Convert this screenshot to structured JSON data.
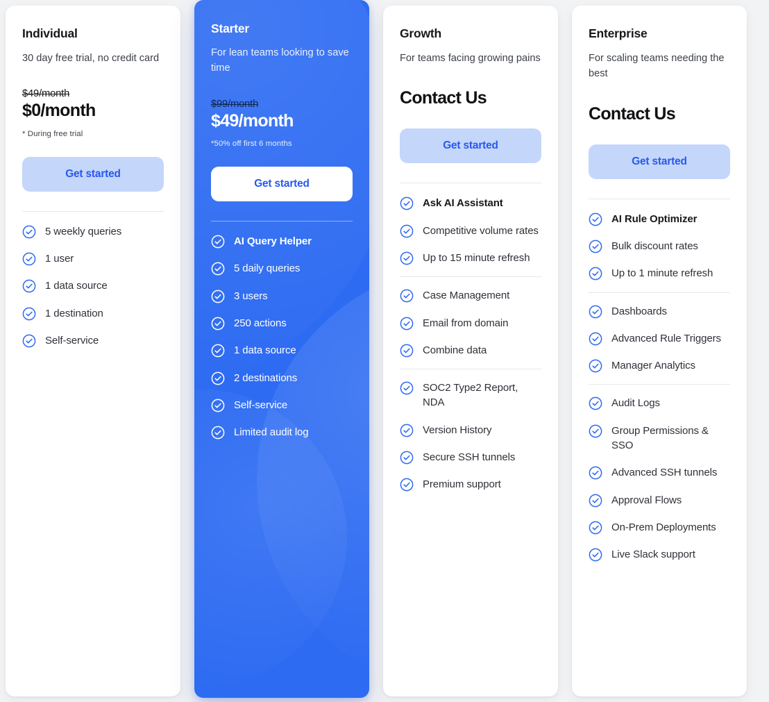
{
  "theme": {
    "page_background": "#f2f3f5",
    "featured_card_background": "#2d6bf2",
    "accent_blue": "#2558ee",
    "cta_light_background": "#c5d6fb",
    "check_icon_color": "#2f6bf0"
  },
  "icons": {
    "check": "check-circle-icon"
  },
  "plans": [
    {
      "id": "individual",
      "name": "Individual",
      "tagline": "30 day free trial, no credit card",
      "price_old": "$49/month",
      "price_new": "$0/month",
      "price_note": "* During free trial",
      "cta_label": "Get started",
      "feature_groups": [
        {
          "items": [
            {
              "label": "5 weekly queries",
              "bold": false
            },
            {
              "label": "1 user",
              "bold": false
            },
            {
              "label": "1 data source",
              "bold": false
            },
            {
              "label": "1 destination",
              "bold": false
            },
            {
              "label": "Self-service",
              "bold": false
            }
          ]
        }
      ]
    },
    {
      "id": "starter",
      "name": "Starter",
      "tagline": "For lean teams looking to save time",
      "price_old": "$99/month",
      "price_new": "$49/month",
      "price_note": "*50% off first 6 months",
      "cta_label": "Get started",
      "feature_groups": [
        {
          "items": [
            {
              "label": "AI Query Helper",
              "bold": true
            },
            {
              "label": "5 daily queries",
              "bold": false
            },
            {
              "label": "3 users",
              "bold": false
            },
            {
              "label": "250 actions",
              "bold": false
            },
            {
              "label": "1 data source",
              "bold": false
            },
            {
              "label": "2 destinations",
              "bold": false
            },
            {
              "label": "Self-service",
              "bold": false
            },
            {
              "label": "Limited audit log",
              "bold": false
            }
          ]
        }
      ]
    },
    {
      "id": "growth",
      "name": "Growth",
      "tagline": "For teams facing growing pains",
      "contact_title": "Contact Us",
      "cta_label": "Get started",
      "feature_groups": [
        {
          "items": [
            {
              "label": "Ask AI Assistant",
              "bold": true
            },
            {
              "label": "Competitive volume rates",
              "bold": false
            },
            {
              "label": "Up to 15 minute refresh",
              "bold": false
            }
          ]
        },
        {
          "items": [
            {
              "label": "Case Management",
              "bold": false
            },
            {
              "label": "Email from domain",
              "bold": false
            },
            {
              "label": "Combine data",
              "bold": false
            }
          ]
        },
        {
          "items": [
            {
              "label": "SOC2 Type2 Report, NDA",
              "bold": false
            },
            {
              "label": "Version History",
              "bold": false
            },
            {
              "label": "Secure SSH tunnels",
              "bold": false
            },
            {
              "label": "Premium support",
              "bold": false
            }
          ]
        }
      ]
    },
    {
      "id": "enterprise",
      "name": "Enterprise",
      "tagline": "For scaling teams needing the best",
      "contact_title": "Contact Us",
      "cta_label": "Get started",
      "feature_groups": [
        {
          "items": [
            {
              "label": "AI Rule Optimizer",
              "bold": true
            },
            {
              "label": "Bulk discount rates",
              "bold": false
            },
            {
              "label": "Up to 1 minute refresh",
              "bold": false
            }
          ]
        },
        {
          "items": [
            {
              "label": "Dashboards",
              "bold": false
            },
            {
              "label": "Advanced Rule Triggers",
              "bold": false
            },
            {
              "label": "Manager Analytics",
              "bold": false
            }
          ]
        },
        {
          "items": [
            {
              "label": "Audit Logs",
              "bold": false
            },
            {
              "label": "Group Permissions & SSO",
              "bold": false
            },
            {
              "label": "Advanced SSH tunnels",
              "bold": false
            },
            {
              "label": "Approval Flows",
              "bold": false
            },
            {
              "label": "On-Prem Deployments",
              "bold": false
            },
            {
              "label": "Live Slack support",
              "bold": false
            }
          ]
        }
      ]
    }
  ]
}
